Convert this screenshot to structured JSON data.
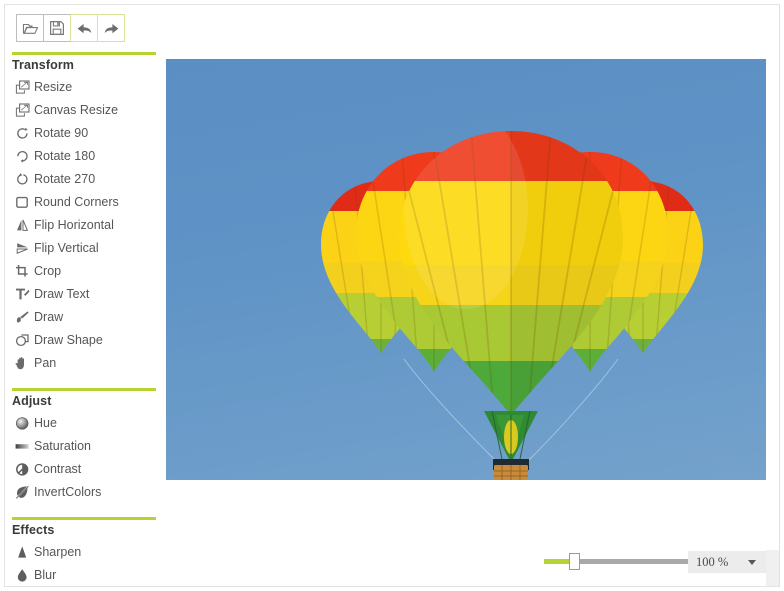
{
  "toolbar": {
    "buttons": [
      {
        "name": "open-file-button",
        "icon": "folder-open-icon",
        "label": "Open",
        "accent": false
      },
      {
        "name": "save-file-button",
        "icon": "save-floppy-icon",
        "label": "Save",
        "accent": false
      },
      {
        "name": "undo-button",
        "icon": "undo-arrow-icon",
        "label": "Undo",
        "accent": true
      },
      {
        "name": "redo-button",
        "icon": "redo-arrow-icon",
        "label": "Redo",
        "accent": true
      }
    ]
  },
  "sidebar": {
    "groups": [
      {
        "title": "Transform",
        "items": [
          {
            "label": "Resize",
            "icon": "resize-icon"
          },
          {
            "label": "Canvas Resize",
            "icon": "canvas-resize-icon"
          },
          {
            "label": "Rotate 90",
            "icon": "rotate-90-icon"
          },
          {
            "label": "Rotate 180",
            "icon": "rotate-180-icon"
          },
          {
            "label": "Rotate 270",
            "icon": "rotate-270-icon"
          },
          {
            "label": "Round Corners",
            "icon": "round-corners-icon"
          },
          {
            "label": "Flip Horizontal",
            "icon": "flip-horizontal-icon"
          },
          {
            "label": "Flip Vertical",
            "icon": "flip-vertical-icon"
          },
          {
            "label": "Crop",
            "icon": "crop-icon"
          },
          {
            "label": "Draw Text",
            "icon": "draw-text-icon"
          },
          {
            "label": "Draw",
            "icon": "draw-brush-icon"
          },
          {
            "label": "Draw Shape",
            "icon": "draw-shape-icon"
          },
          {
            "label": "Pan",
            "icon": "pan-hand-icon"
          }
        ]
      },
      {
        "title": "Adjust",
        "items": [
          {
            "label": "Hue",
            "icon": "hue-sphere-icon"
          },
          {
            "label": "Saturation",
            "icon": "saturation-bar-icon"
          },
          {
            "label": "Contrast",
            "icon": "contrast-circle-icon"
          },
          {
            "label": "InvertColors",
            "icon": "invert-colors-icon"
          }
        ]
      },
      {
        "title": "Effects",
        "items": [
          {
            "label": "Sharpen",
            "icon": "sharpen-cone-icon"
          },
          {
            "label": "Blur",
            "icon": "blur-drop-icon"
          }
        ]
      }
    ]
  },
  "canvas": {
    "image_alt": "Hot air balloon with red, yellow and green panels against a clear blue sky"
  },
  "statusbar": {
    "zoom_value": "100 %",
    "zoom_percent": 100,
    "slider_min": 0,
    "slider_max": 100,
    "slider_position_percent": 18
  },
  "colors": {
    "accent_green": "#b5d334",
    "sky_blue": "#5f93c6",
    "balloon_red": "#e8251d",
    "balloon_yellow": "#fad211",
    "balloon_green": "#5fa92f",
    "text_gray": "#565656",
    "panel_gray": "#ececec"
  }
}
